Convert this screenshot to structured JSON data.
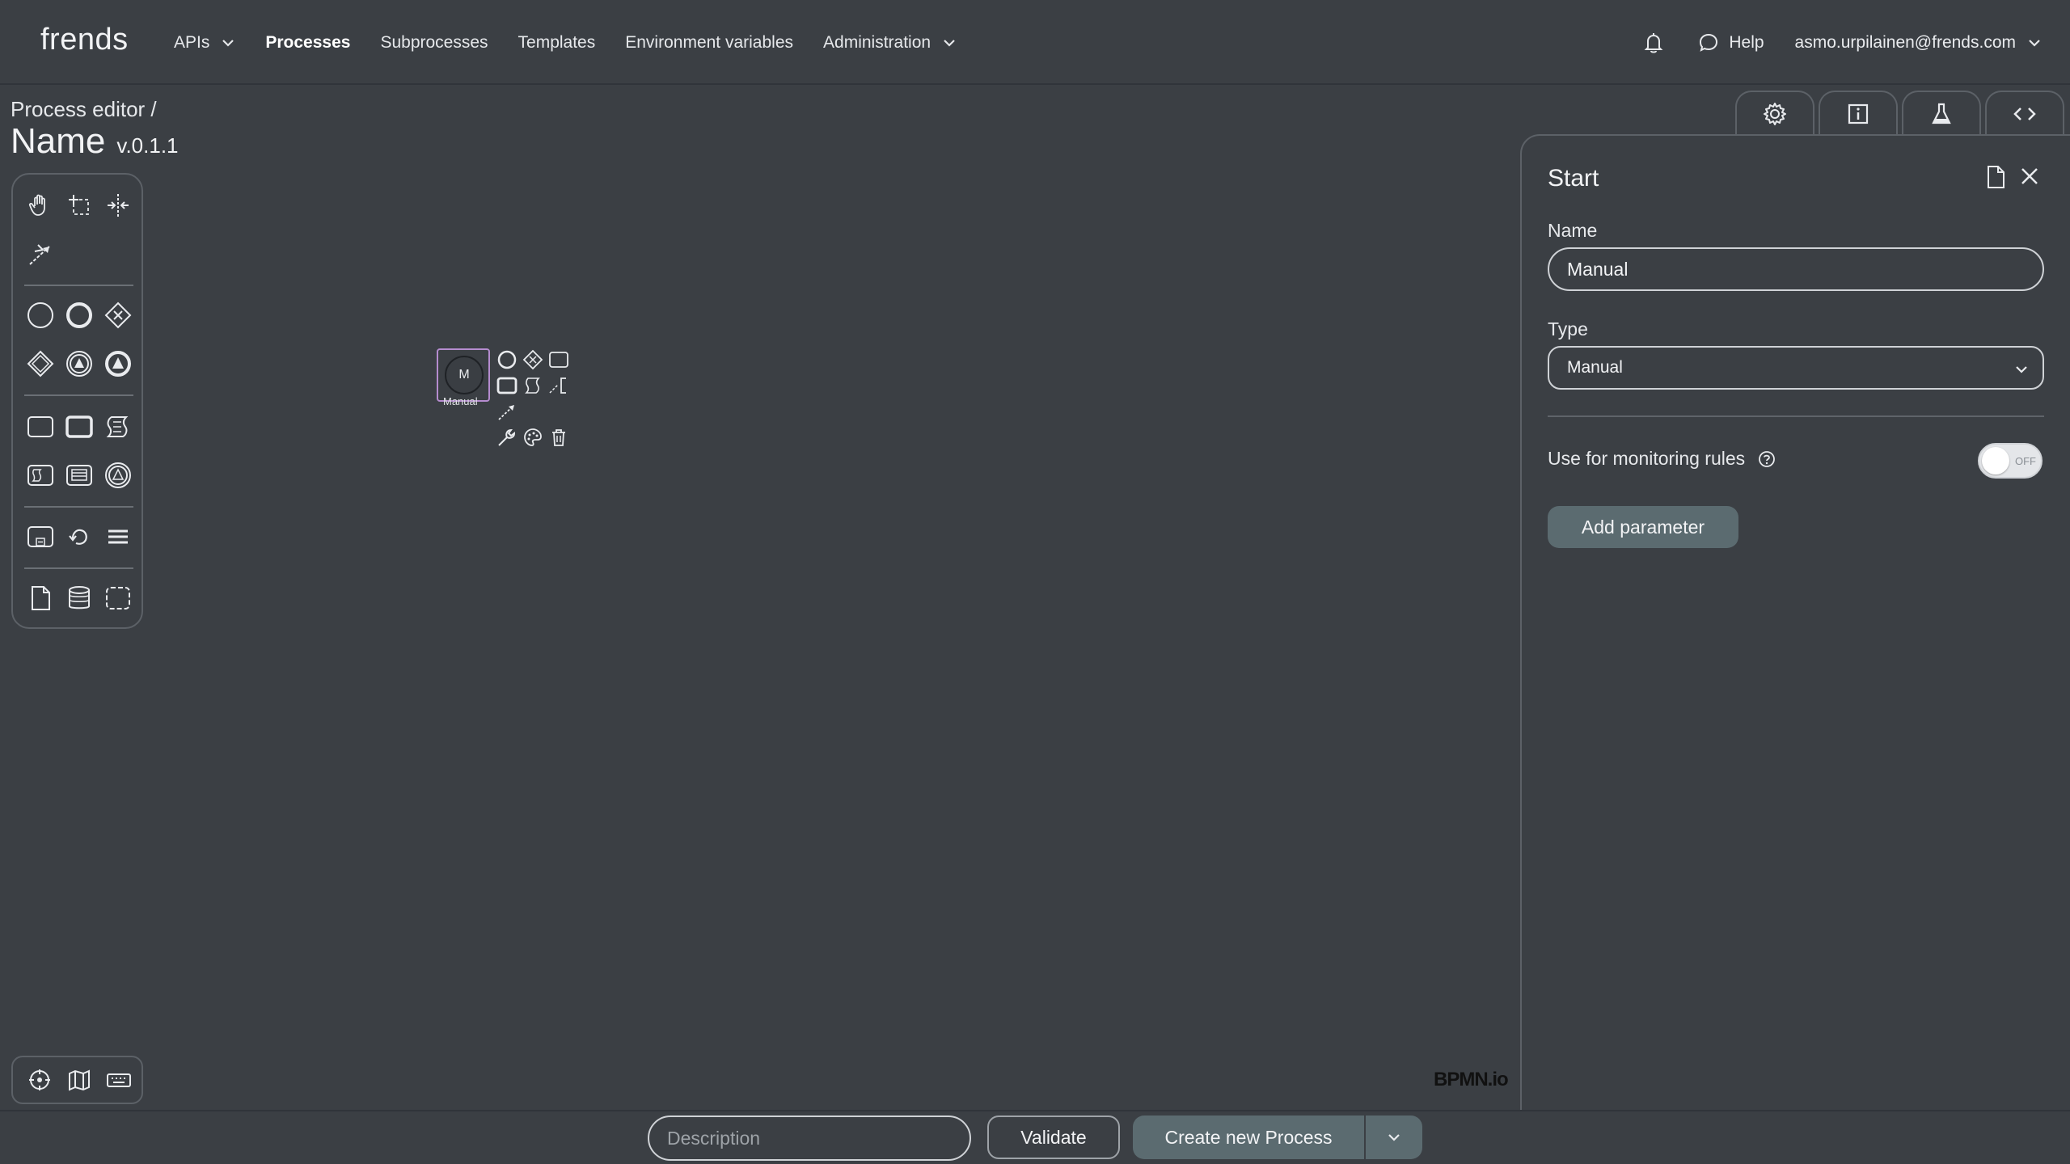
{
  "app": {
    "logo": "frends"
  },
  "nav": {
    "items": [
      {
        "label": "APIs",
        "dropdown": true
      },
      {
        "label": "Processes",
        "active": true
      },
      {
        "label": "Subprocesses"
      },
      {
        "label": "Templates"
      },
      {
        "label": "Environment variables"
      },
      {
        "label": "Administration",
        "dropdown": true
      }
    ],
    "help_label": "Help",
    "user_email": "asmo.urpilainen@frends.com"
  },
  "breadcrumb": {
    "section": "Process editor /"
  },
  "process": {
    "name": "Name",
    "version": "v.0.1.1"
  },
  "palette": {
    "icons": [
      "hand-tool-icon",
      "lasso-tool-icon",
      "space-tool-icon",
      "connect-tool-icon",
      "start-event-icon",
      "end-event-icon",
      "exclusive-gateway-icon",
      "parallel-gateway-icon",
      "intermediate-event-icon",
      "escalation-event-icon",
      "task-icon",
      "subprocess-icon",
      "script-task-icon",
      "call-activity-icon",
      "table-icon",
      "signal-event-icon",
      "collapsed-subprocess-icon",
      "loop-icon",
      "list-icon",
      "data-object-icon",
      "data-store-icon",
      "group-icon"
    ]
  },
  "canvas": {
    "start_node": {
      "symbol": "M",
      "label": "Manual"
    },
    "watermark": "BPMN.io"
  },
  "panel": {
    "title": "Start",
    "name_label": "Name",
    "name_value": "Manual",
    "type_label": "Type",
    "type_value": "Manual",
    "monitoring_label": "Use for monitoring rules",
    "monitoring_toggle": "OFF",
    "add_parameter": "Add parameter"
  },
  "bottom": {
    "description_placeholder": "Description",
    "validate": "Validate",
    "create": "Create new Process"
  },
  "colors": {
    "background": "#3b3f44",
    "accent_button": "#5b6b70",
    "selection": "#b58ccf"
  }
}
